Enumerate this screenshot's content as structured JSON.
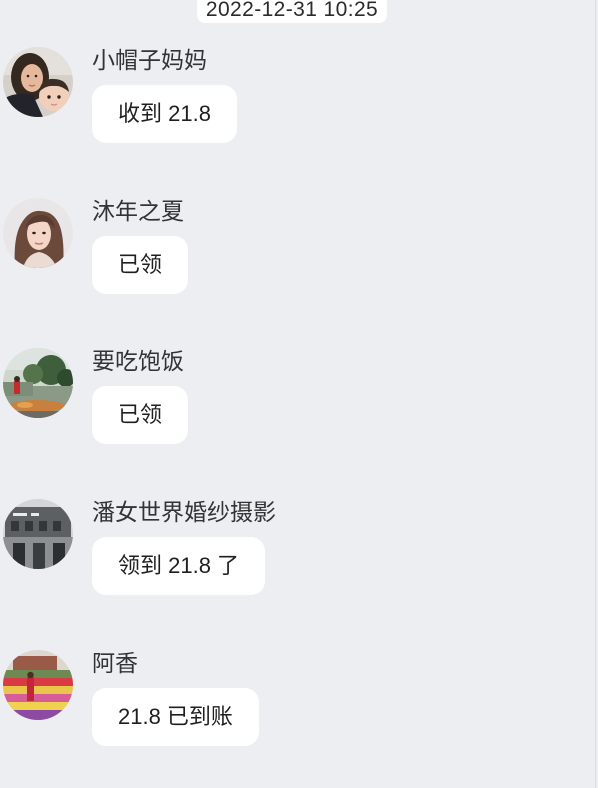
{
  "colors": {
    "background": "#edeef2",
    "bubble": "#ffffff",
    "sender_name": "#333333"
  },
  "timestamp": "2022-12-31 10:25",
  "messages": [
    {
      "sender": "小帽子妈妈",
      "text": "收到 21.8"
    },
    {
      "sender": "沐年之夏",
      "text": "已领"
    },
    {
      "sender": "要吃饱饭",
      "text": "已领"
    },
    {
      "sender": "潘女世界婚纱摄影",
      "text": "领到 21.8 了"
    },
    {
      "sender": "阿香",
      "text": "21.8 已到账"
    }
  ]
}
